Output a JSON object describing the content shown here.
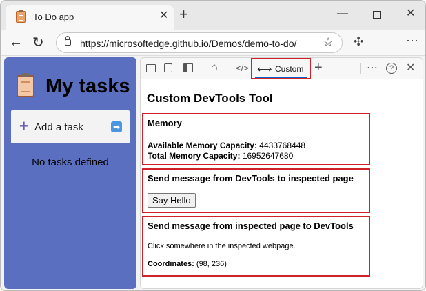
{
  "browser": {
    "tab_title": "To Do app",
    "url": "https://microsoftedge.github.io/Demos/demo-to-do/",
    "icons": {
      "tab_favicon": "clipboard-icon",
      "tab_close": "close-icon",
      "new_tab": "plus-icon",
      "minimize": "minimize-icon",
      "maximize": "maximize-icon",
      "window_close": "close-icon",
      "back": "back-arrow-icon",
      "refresh": "refresh-icon",
      "lock": "lock-icon",
      "favorite": "star-icon",
      "extensions": "puzzle-icon",
      "menu": "more-icon"
    }
  },
  "app": {
    "title": "My tasks",
    "add_task_label": "Add a task",
    "empty_text": "No tasks defined",
    "accent_color": "#5a6fc0"
  },
  "devtools": {
    "toolbar": {
      "custom_tab_label": "Custom",
      "icons": [
        "inspect-icon",
        "device-emulation-icon",
        "dock-icon",
        "home-icon",
        "code-icon",
        "swap-arrows-icon",
        "plus-icon",
        "more-icon",
        "help-icon",
        "close-icon"
      ]
    },
    "panel": {
      "title": "Custom DevTools Tool",
      "memory": {
        "heading": "Memory",
        "available_label": "Available Memory Capacity:",
        "available_value": "4433768448",
        "total_label": "Total Memory Capacity:",
        "total_value": "16952647680"
      },
      "send_to_page": {
        "heading": "Send message from DevTools to inspected page",
        "button_label": "Say Hello"
      },
      "send_from_page": {
        "heading": "Send message from inspected page to DevTools",
        "hint": "Click somewhere in the inspected webpage.",
        "coordinates_label": "Coordinates:",
        "coordinates_value": "(98, 236)"
      },
      "highlight_color": "#d0222b"
    }
  }
}
